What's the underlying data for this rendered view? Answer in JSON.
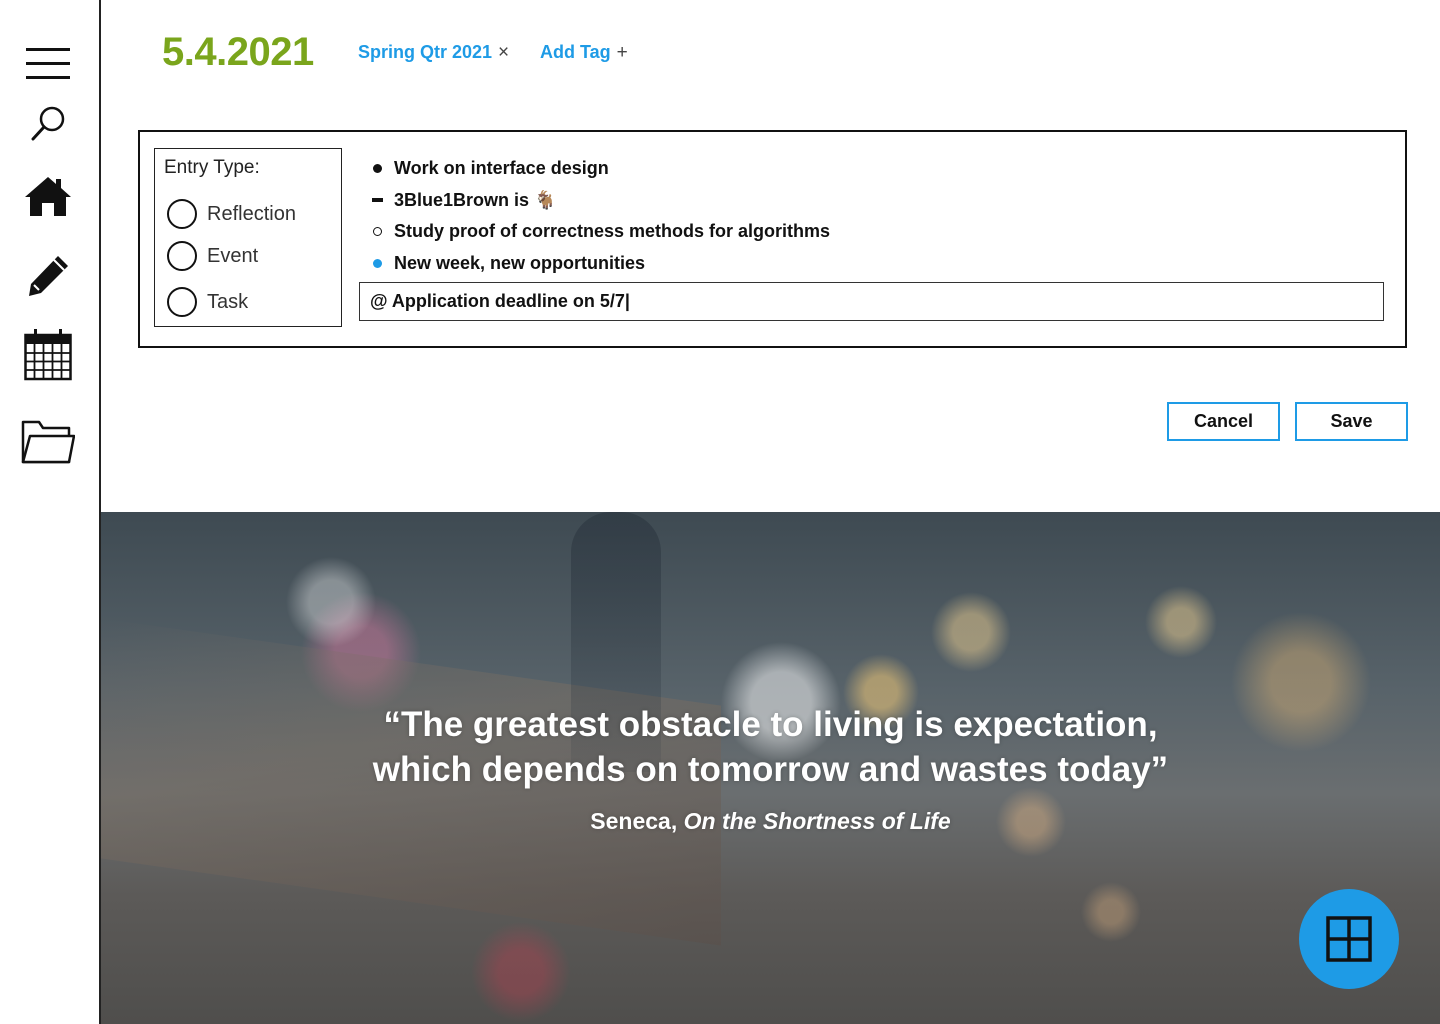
{
  "sidebar": {
    "items": [
      {
        "name": "menu-icon"
      },
      {
        "name": "search-icon"
      },
      {
        "name": "home-icon"
      },
      {
        "name": "pencil-icon"
      },
      {
        "name": "calendar-icon"
      },
      {
        "name": "folder-icon"
      }
    ]
  },
  "header": {
    "date": "5.4.2021",
    "tags": [
      {
        "label": "Spring Qtr 2021",
        "symbol": "×"
      },
      {
        "label": "Add Tag",
        "symbol": "+"
      }
    ]
  },
  "entry": {
    "type_label": "Entry Type:",
    "types": [
      "Reflection",
      "Event",
      "Task"
    ],
    "bullets": [
      {
        "kind": "filled-dot",
        "text": "Work on interface design"
      },
      {
        "kind": "dash",
        "text": "3Blue1Brown is 🐐"
      },
      {
        "kind": "open-circle",
        "text": "Study proof of correctness methods for algorithms"
      },
      {
        "kind": "blue-dot",
        "text": "New week, new opportunities"
      }
    ],
    "input_value": "@ Application deadline on 5/7|"
  },
  "actions": {
    "cancel_label": "Cancel",
    "save_label": "Save"
  },
  "quote": {
    "line1": "“The greatest obstacle to living is expectation,",
    "line2": "which depends on tomorrow and wastes today”",
    "author": "Seneca,",
    "work": "On the Shortness of Life"
  },
  "colors": {
    "date_green": "#7aa51c",
    "accent_blue": "#1e9be6"
  },
  "fab": {
    "icon": "grid-icon"
  }
}
